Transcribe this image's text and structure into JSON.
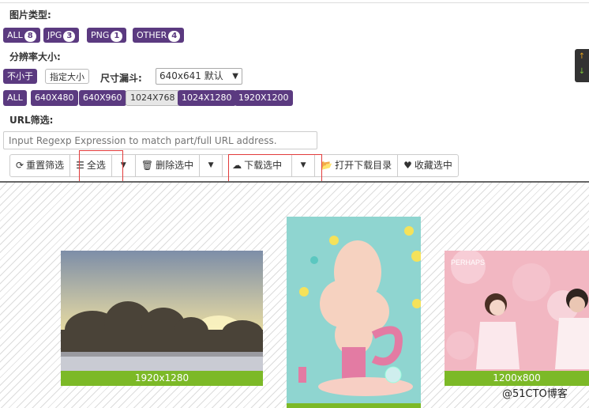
{
  "filters": {
    "type_label": "图片类型:",
    "types": [
      {
        "label": "ALL",
        "count": "8"
      },
      {
        "label": "JPG",
        "count": "3"
      },
      {
        "label": "PNG",
        "count": "1"
      },
      {
        "label": "OTHER",
        "count": "4"
      }
    ],
    "resolution_label": "分辨率大小:",
    "not_less_label": "不小于",
    "specify_label": "指定大小",
    "funnel_label": "尺寸漏斗:",
    "funnel_value": "640x641 默认",
    "sizes": [
      "ALL",
      "640X480",
      "640X960",
      "1024X768",
      "1024X1280",
      "1920X1200"
    ],
    "url_label": "URL筛选:",
    "url_placeholder": "Input Regexp Expression to match part/full URL address."
  },
  "toolbar": {
    "reset": "重置筛选",
    "select_all": "全选",
    "delete_selected": "删除选中",
    "download_selected": "下载选中",
    "open_dir": "打开下载目录",
    "favorite_selected": "收藏选中"
  },
  "gallery": {
    "images": [
      {
        "resolution": "1920x1280"
      },
      {
        "resolution": ""
      },
      {
        "resolution": "1200x800",
        "overlay_text": "PERHAPS"
      }
    ]
  },
  "watermark": "@51CTO博客",
  "colors": {
    "tag_bg": "#5b3a80",
    "res_bar": "#7cb927",
    "highlight": "#e23b3b"
  }
}
